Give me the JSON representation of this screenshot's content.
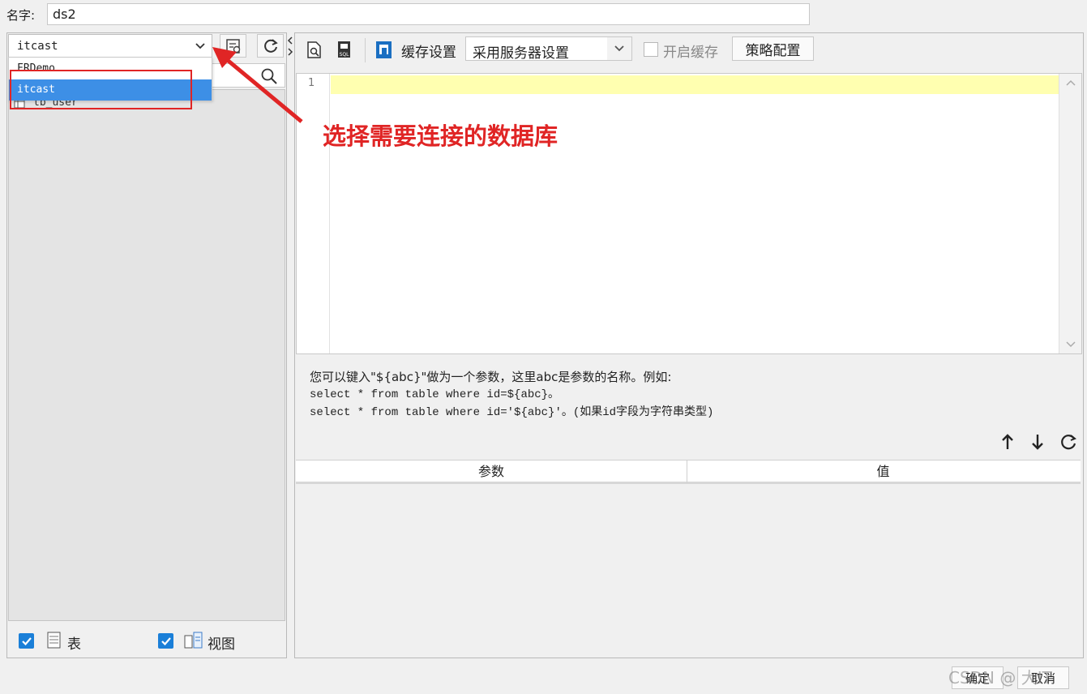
{
  "name_row": {
    "label": "名字:",
    "value": "ds2"
  },
  "left": {
    "db_select": {
      "value": "itcast",
      "options": [
        "FRDemo",
        "itcast"
      ],
      "highlighted": "itcast"
    },
    "tree": {
      "items": [
        "tb_user"
      ]
    },
    "footer": {
      "table_label": "表",
      "view_label": "视图",
      "table_checked": true,
      "view_checked": true
    }
  },
  "toolbar": {
    "cache_settings_label": "缓存设置",
    "cache_mode_value": "采用服务器设置",
    "enable_cache_label": "开启缓存",
    "strategy_button": "策略配置"
  },
  "editor": {
    "line_number": "1"
  },
  "hint": {
    "line1": "您可以键入\"${abc}\"做为一个参数，这里abc是参数的名称。例如:",
    "line2": "select * from table where id=${abc}。",
    "line3": "select * from table where id='${abc}'。(如果id字段为字符串类型)"
  },
  "param_table": {
    "col_param": "参数",
    "col_value": "值"
  },
  "buttons": {
    "ok": "确定",
    "cancel": "取消"
  },
  "annotation": {
    "text": "选择需要连接的数据库",
    "color": "#e02525"
  },
  "watermark": "CSDN @ 大IT",
  "colors": {
    "accent_blue": "#3d8fe6",
    "highlight_red": "#e02525",
    "current_line": "#ffffb0"
  }
}
